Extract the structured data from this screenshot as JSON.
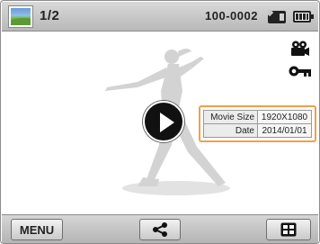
{
  "status_bar": {
    "counter": "1/2",
    "file_number": "100-0002",
    "icons": [
      "landscape-thumbnail-icon",
      "memory-card-icon",
      "battery-full-icon"
    ]
  },
  "indicators": [
    "video-camera-icon",
    "protect-key-icon"
  ],
  "info_box": {
    "rows": [
      {
        "label": "Movie Size",
        "value": "1920X1080"
      },
      {
        "label": "Date",
        "value": "2014/01/01"
      }
    ],
    "border_color": "#f0a04a"
  },
  "bottom_bar": {
    "menu_label": "MENU",
    "share_icon": "share-icon",
    "view_icon": "view-mode-icon"
  }
}
